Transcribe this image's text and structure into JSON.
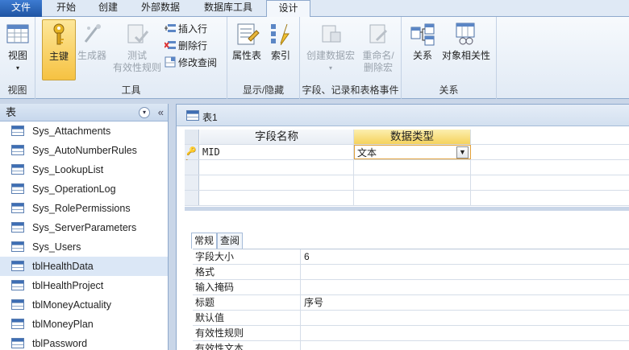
{
  "tabs": [
    {
      "label": "文件"
    },
    {
      "label": "开始"
    },
    {
      "label": "创建"
    },
    {
      "label": "外部数据"
    },
    {
      "label": "数据库工具"
    },
    {
      "label": "设计"
    }
  ],
  "ribbon": {
    "view": {
      "label": "视图",
      "group": "视图"
    },
    "tools": {
      "group": "工具",
      "primary_key": "主键",
      "builder": "生成器",
      "test_rules_line1": "测试",
      "test_rules_line2": "有效性规则",
      "insert_rows": "插入行",
      "delete_rows": "删除行",
      "modify_lookups": "修改查阅"
    },
    "show_hide": {
      "group": "显示/隐藏",
      "property_sheet": "属性表",
      "indexes": "索引"
    },
    "field_events": {
      "group": "字段、记录和表格事件",
      "create_macros": "创建数据宏",
      "rename_line1": "重命名/",
      "rename_line2": "删除宏"
    },
    "relationships": {
      "group": "关系",
      "relationships": "关系",
      "dependencies": "对象相关性"
    }
  },
  "nav": {
    "header": "表",
    "items": [
      {
        "label": "Sys_Attachments"
      },
      {
        "label": "Sys_AutoNumberRules"
      },
      {
        "label": "Sys_LookupList"
      },
      {
        "label": "Sys_OperationLog"
      },
      {
        "label": "Sys_RolePermissions"
      },
      {
        "label": "Sys_ServerParameters"
      },
      {
        "label": "Sys_Users"
      },
      {
        "label": "tblHealthData"
      },
      {
        "label": "tblHealthProject"
      },
      {
        "label": "tblMoneyActuality"
      },
      {
        "label": "tblMoneyPlan"
      },
      {
        "label": "tblPassword"
      }
    ]
  },
  "document": {
    "tab_title": "表1",
    "columns": {
      "field_name": "字段名称",
      "data_type": "数据类型"
    },
    "rows": [
      {
        "field_name": "MID",
        "data_type": "文本"
      }
    ]
  },
  "properties": {
    "tabs": [
      "常规",
      "查阅"
    ],
    "rows": [
      {
        "label": "字段大小",
        "value": "6"
      },
      {
        "label": "格式",
        "value": ""
      },
      {
        "label": "输入掩码",
        "value": ""
      },
      {
        "label": "标题",
        "value": "序号"
      },
      {
        "label": "默认值",
        "value": ""
      },
      {
        "label": "有效性规则",
        "value": ""
      },
      {
        "label": "有效性文本",
        "value": ""
      }
    ]
  },
  "colors": {
    "accent_file": "#2a62b6",
    "pressed": "#f6c242",
    "selection": "#dbe7f6"
  }
}
